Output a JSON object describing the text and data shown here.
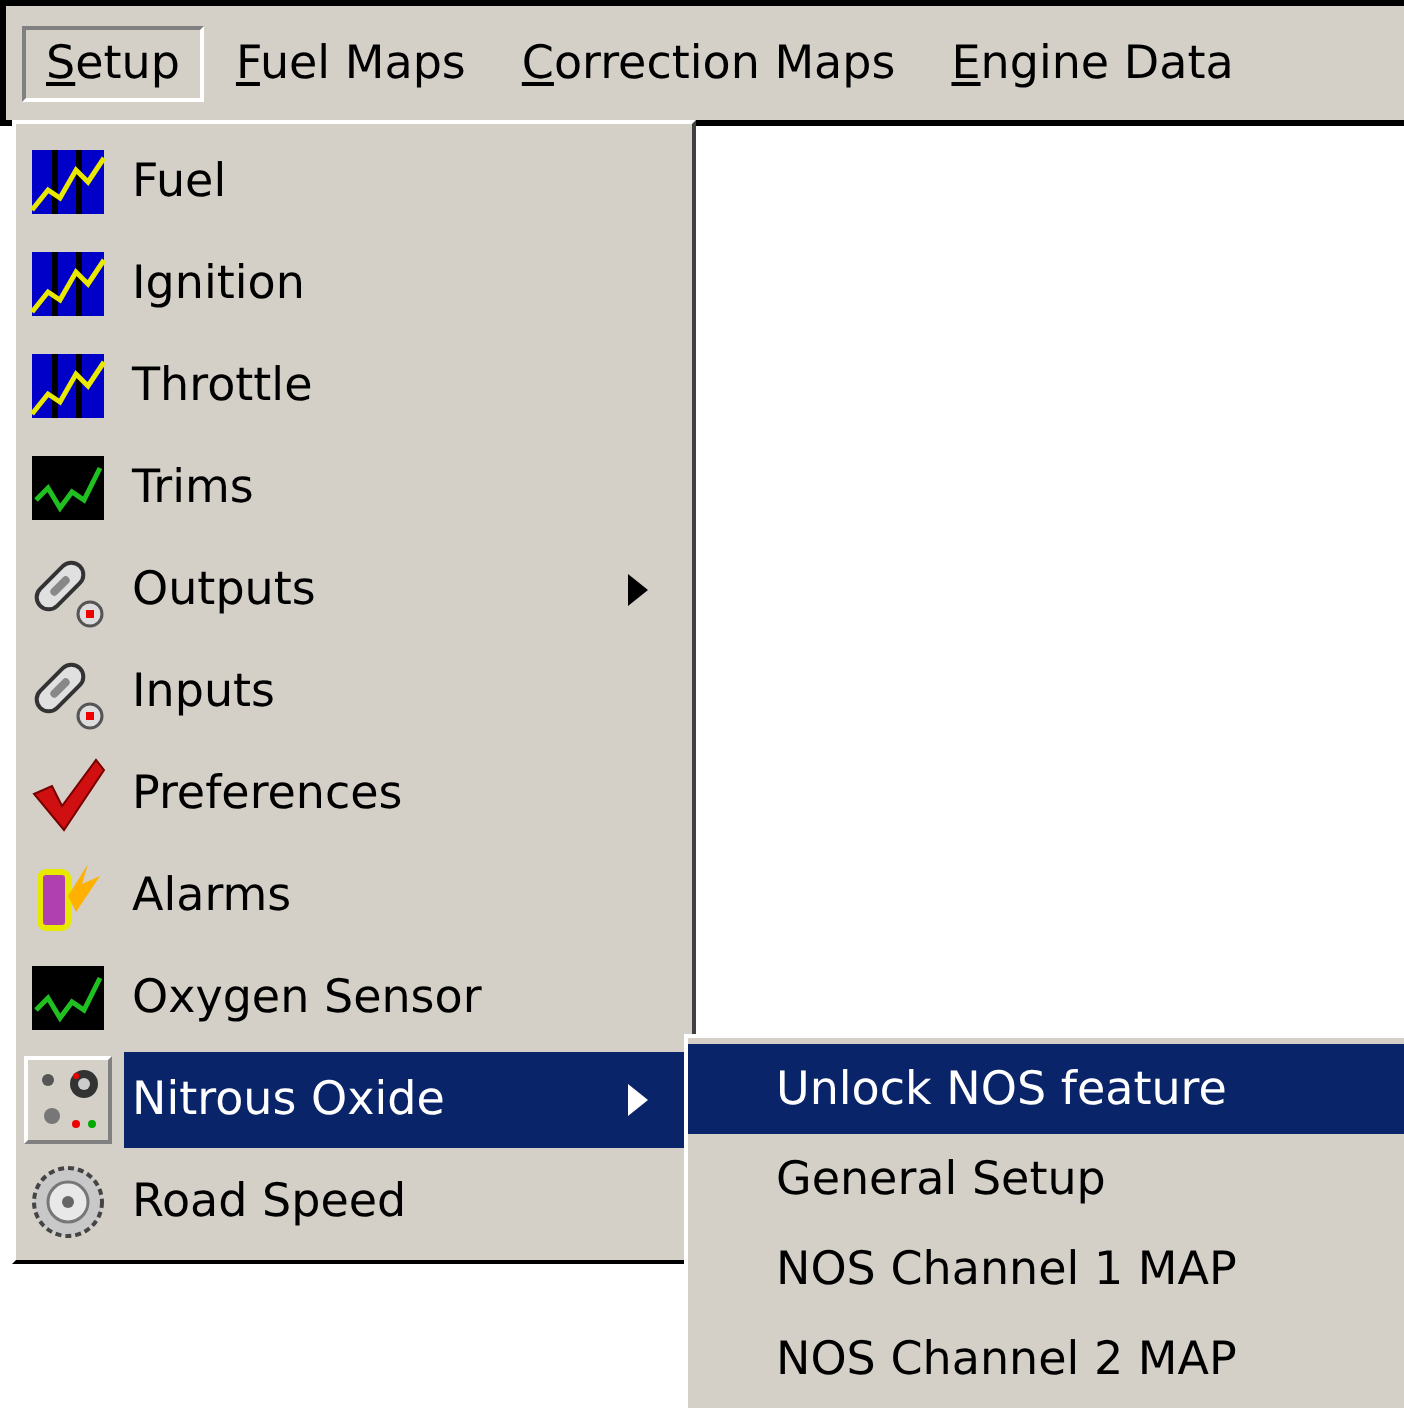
{
  "menu_bar": [
    {
      "label": "Setup",
      "selected": true
    },
    {
      "label": "Fuel Maps",
      "selected": false
    },
    {
      "label": "Correction Maps",
      "selected": false
    },
    {
      "label": "Engine Data",
      "selected": false
    }
  ],
  "setup_menu": [
    {
      "label": "Fuel",
      "kind": "map",
      "selected": false,
      "has_submenu": false
    },
    {
      "label": "Ignition",
      "kind": "map",
      "selected": false,
      "has_submenu": false
    },
    {
      "label": "Throttle",
      "kind": "map",
      "selected": false,
      "has_submenu": false
    },
    {
      "label": "Trims",
      "kind": "trace",
      "selected": false,
      "has_submenu": false
    },
    {
      "label": "Outputs",
      "kind": "link",
      "selected": false,
      "has_submenu": true
    },
    {
      "label": "Inputs",
      "kind": "link",
      "selected": false,
      "has_submenu": false
    },
    {
      "label": "Preferences",
      "kind": "check",
      "selected": false,
      "has_submenu": false
    },
    {
      "label": "Alarms",
      "kind": "alarm",
      "selected": false,
      "has_submenu": false
    },
    {
      "label": "Oxygen Sensor",
      "kind": "trace",
      "selected": false,
      "has_submenu": false
    },
    {
      "label": "Nitrous Oxide",
      "kind": "nitrous",
      "selected": true,
      "has_submenu": true
    },
    {
      "label": "Road Speed",
      "kind": "wheel",
      "selected": false,
      "has_submenu": false
    }
  ],
  "nitrous_submenu": [
    {
      "label": "Unlock NOS feature",
      "selected": true
    },
    {
      "label": "General Setup",
      "selected": false
    },
    {
      "label": "NOS Channel 1 MAP",
      "selected": false
    },
    {
      "label": "NOS Channel 2 MAP",
      "selected": false
    }
  ]
}
